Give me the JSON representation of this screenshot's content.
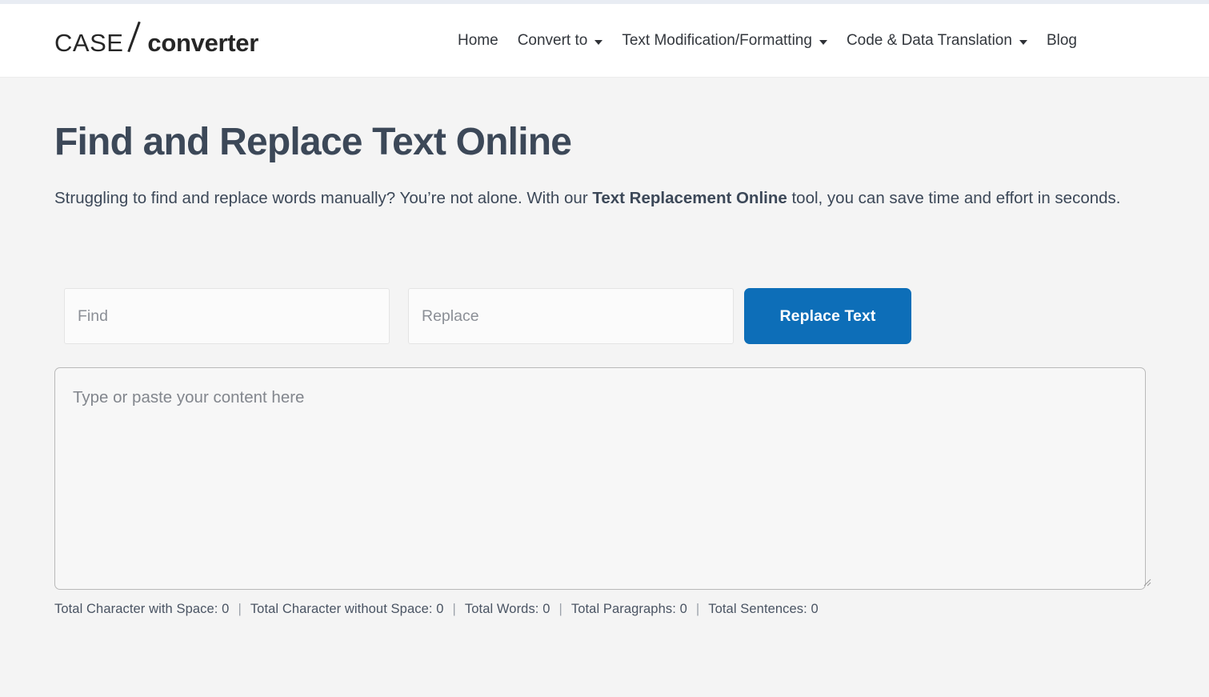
{
  "theme": {
    "accent_blue": "#0d6eb8",
    "page_bg": "#f4f4f4",
    "header_bg": "#ffffff",
    "text_color": "#3c4858",
    "top_strip": "#e8ecf3"
  },
  "header": {
    "logo": {
      "first": "CASE",
      "separator": "/",
      "second": "converter"
    },
    "nav": [
      {
        "label": "Home",
        "has_dropdown": false
      },
      {
        "label": "Convert to",
        "has_dropdown": true
      },
      {
        "label": "Text Modification/Formatting",
        "has_dropdown": true
      },
      {
        "label": "Code & Data Translation",
        "has_dropdown": true
      },
      {
        "label": "Blog",
        "has_dropdown": false
      }
    ]
  },
  "main": {
    "title": "Find and Replace Text Online",
    "subtitle_part1": "Struggling to find and replace words manually? You’re not alone. With our ",
    "subtitle_bold": "Text Replacement Online",
    "subtitle_part2": " tool, you can save time and effort in seconds.",
    "find_placeholder": "Find",
    "find_value": "",
    "replace_placeholder": "Replace",
    "replace_value": "",
    "replace_button_label": "Replace Text",
    "textarea_placeholder": "Type or paste your content here",
    "textarea_value": "",
    "stats": [
      {
        "label": "Total Character with Space:",
        "value": "0"
      },
      {
        "label": "Total Character without Space:",
        "value": "0"
      },
      {
        "label": "Total Words:",
        "value": "0"
      },
      {
        "label": "Total Paragraphs:",
        "value": "0"
      },
      {
        "label": "Total Sentences:",
        "value": "0"
      }
    ],
    "stat_separator": "|"
  }
}
